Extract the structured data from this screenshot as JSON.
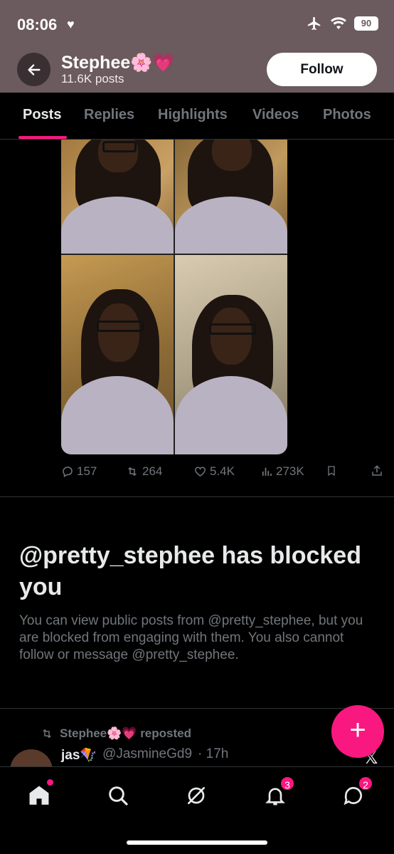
{
  "status_bar": {
    "time": "08:06",
    "battery": "90"
  },
  "header": {
    "name": "Stephee🌸💗",
    "posts_count": "11.6K posts",
    "follow_label": "Follow"
  },
  "tabs": [
    {
      "label": "Posts",
      "active": true
    },
    {
      "label": "Replies",
      "active": false
    },
    {
      "label": "Highlights",
      "active": false
    },
    {
      "label": "Videos",
      "active": false
    },
    {
      "label": "Photos",
      "active": false
    }
  ],
  "post_actions": {
    "replies": "157",
    "reposts": "264",
    "likes": "5.4K",
    "views": "273K"
  },
  "blocked": {
    "title": "@pretty_stephee has blocked you",
    "description": "You can view public posts from @pretty_stephee, but you are blocked from engaging with them. You also cannot follow or message @pretty_stephee."
  },
  "next_tweet": {
    "repost_text": "Stephee🌸💗 reposted",
    "author_name": "jas🪁",
    "author_handle": "@JasmineGd9",
    "time": "· 17h"
  },
  "nav": {
    "notifications_badge": "3",
    "messages_badge": "2"
  },
  "colors": {
    "accent": "#f91880",
    "header_bg": "#6b5a5e",
    "muted": "#71767b"
  }
}
